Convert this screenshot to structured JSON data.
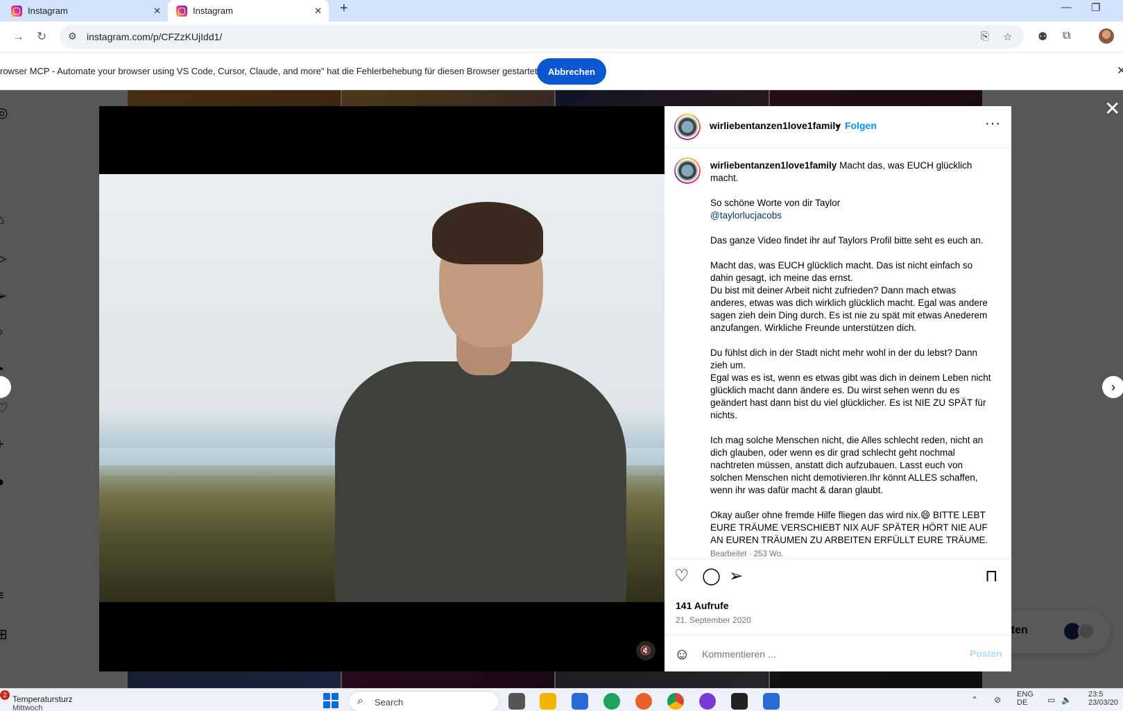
{
  "browser": {
    "tabs": [
      {
        "title": "Instagram",
        "active": false
      },
      {
        "title": "Instagram",
        "active": true
      }
    ],
    "url": "instagram.com/p/CFZzKUjIdd1/",
    "debug_message": "rowser MCP - Automate your browser using VS Code, Cursor, Claude, and more\" hat die Fehlerbehebung für diesen Browser gestartet",
    "debug_cancel": "Abbrechen"
  },
  "post": {
    "username": "wirliebentanzen1love1family",
    "follow": "Folgen",
    "caption_username": "wirliebentanzen1love1family",
    "caption_lead": "Macht das, was EUCH glücklich macht.",
    "paragraphs": [
      "So schöne Worte von dir Taylor",
      "Das ganze Video findet ihr auf Taylors Profil bitte seht es euch an.",
      "Macht das, was EUCH glücklich macht. Das ist nicht einfach so dahin gesagt, ich meine das ernst.\nDu bist mit deiner Arbeit nicht zufrieden? Dann mach etwas anderes, etwas was dich wirklich glücklich macht. Egal was andere sagen zieh dein Ding durch. Es ist nie zu spät mit etwas Anederem anzufangen. Wirkliche Freunde unterstützen dich.",
      "Du fühlst dich in der Stadt nicht mehr wohl in der du lebst? Dann zieh um.\nEgal was es ist, wenn es etwas gibt was dich in deinem Leben nicht glücklich macht dann ändere es. Du wirst sehen wenn du es geändert hast dann bist du viel glücklicher. Es ist NIE ZU SPÄT für nichts.",
      "Ich mag solche Menschen nicht, die Alles schlecht reden, nicht an dich glauben, oder wenn es dir grad schlecht geht nochmal nachtreten müssen, anstatt dich aufzubauen. Lasst euch von solchen Menschen nicht demotivieren.Ihr könnt ALLES schaffen, wenn ihr was dafür macht & daran glaubt.",
      "Okay außer ohne fremde Hilfe fliegen das wird nix.😄 BITTE LEBT EURE TRÄUME VERSCHIEBT NIX AUF SPÄTER HÖRT NIE AUF AN EUREN TRÄUMEN ZU ARBEITEN ERFÜLLT EURE TRÄUME."
    ],
    "mention": "@taylorlucjacobs",
    "edited_meta": "Bearbeitet · 253 Wo.",
    "views": "141 Aufrufe",
    "date": "21. September 2020",
    "comment_placeholder": "Kommentieren ...",
    "post_button": "Posten"
  },
  "background": {
    "pill_label": "nten"
  },
  "taskbar": {
    "weather_title": "Temperatursturz",
    "weather_sub": "Mittwoch",
    "weather_badge": "2",
    "search": "Search",
    "lang_top": "ENG",
    "lang_bottom": "DE",
    "time": "23:5",
    "date": "23/03/20"
  },
  "colors": {
    "follow_blue": "#0095f6",
    "cancel_button": "#0b57d0",
    "tab_strip": "#d3e3fd"
  }
}
